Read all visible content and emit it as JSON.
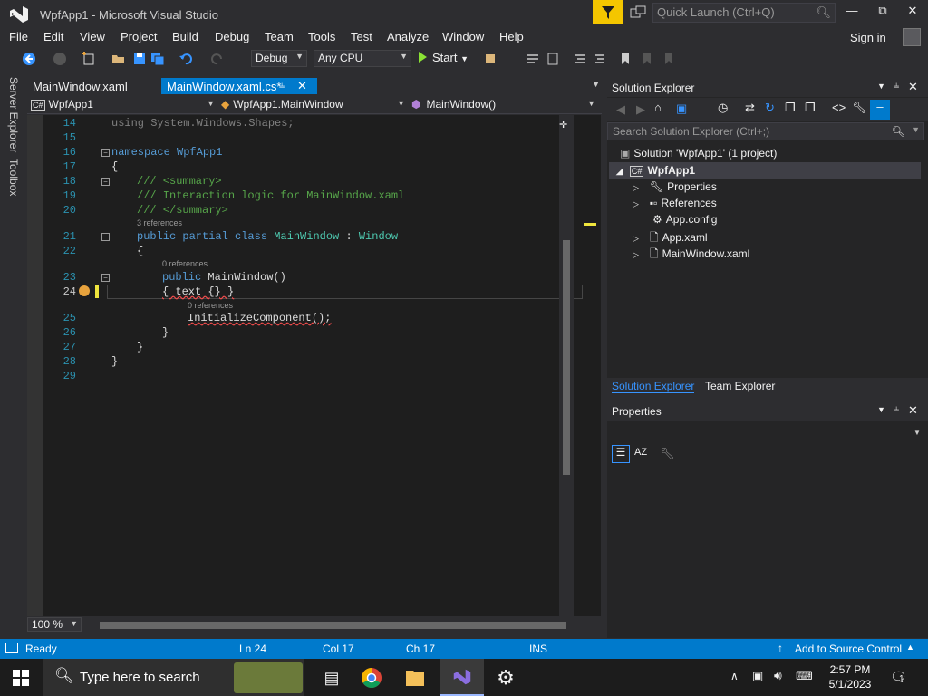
{
  "window": {
    "title": "WpfApp1 - Microsoft Visual Studio"
  },
  "quick_launch": {
    "placeholder": "Quick Launch (Ctrl+Q)"
  },
  "menu": [
    "File",
    "Edit",
    "View",
    "Project",
    "Build",
    "Debug",
    "Team",
    "Tools",
    "Test",
    "Analyze",
    "Window",
    "Help"
  ],
  "signin": "Sign in",
  "toolbar": {
    "configuration": "Debug",
    "platform": "Any CPU",
    "start_label": "Start"
  },
  "side_tabs": [
    "Server Explorer",
    "Toolbox"
  ],
  "doc_tabs": [
    {
      "label": "MainWindow.xaml"
    },
    {
      "label": "MainWindow.xaml.cs*"
    }
  ],
  "nav": {
    "project": "WpfApp1",
    "class": "WpfApp1.MainWindow",
    "member": "MainWindow()"
  },
  "code_lines": [
    {
      "n": "14",
      "text": "using System.Windows.Shapes;"
    },
    {
      "n": "15",
      "text": ""
    },
    {
      "n": "16",
      "text": "namespace WpfApp1"
    },
    {
      "n": "17",
      "text": "{"
    },
    {
      "n": "18",
      "text": "/// <summary>"
    },
    {
      "n": "19",
      "text": "/// Interaction logic for MainWindow.xaml"
    },
    {
      "n": "20",
      "text": "/// </summary>"
    },
    {
      "n": "21",
      "text": "public partial class MainWindow : Window"
    },
    {
      "n": "22",
      "text": "{"
    },
    {
      "n": "23",
      "text": "public MainWindow()"
    },
    {
      "n": "24",
      "text": "{ text {} }"
    },
    {
      "n": "25",
      "text": "InitializeComponent();"
    },
    {
      "n": "26",
      "text": "}"
    },
    {
      "n": "27",
      "text": "}"
    },
    {
      "n": "28",
      "text": "}"
    },
    {
      "n": "29",
      "text": ""
    }
  ],
  "codelens": {
    "class_refs": "3 references",
    "ctor_refs": "0 references",
    "init_refs": "0 references"
  },
  "zoom": "100 %",
  "solution_explorer": {
    "title": "Solution Explorer",
    "search_placeholder": "Search Solution Explorer (Ctrl+;)",
    "solution": "Solution 'WpfApp1' (1 project)",
    "project": "WpfApp1",
    "items": [
      "Properties",
      "References",
      "App.config",
      "App.xaml",
      "MainWindow.xaml"
    ],
    "tabs": [
      "Solution Explorer",
      "Team Explorer"
    ]
  },
  "properties": {
    "title": "Properties"
  },
  "status": {
    "ready": "Ready",
    "ln": "Ln 24",
    "col": "Col 17",
    "ch": "Ch 17",
    "ins": "INS",
    "source_control": "Add to Source Control"
  },
  "taskbar": {
    "search_placeholder": "Type here to search",
    "time": "2:57 PM",
    "date": "5/1/2023",
    "notif_count": "1"
  },
  "colors": {
    "accent": "#007acc",
    "editor_bg": "#1e1e1e",
    "keyword": "#569cd6",
    "comment": "#57a64a",
    "type": "#4ec9b0"
  }
}
